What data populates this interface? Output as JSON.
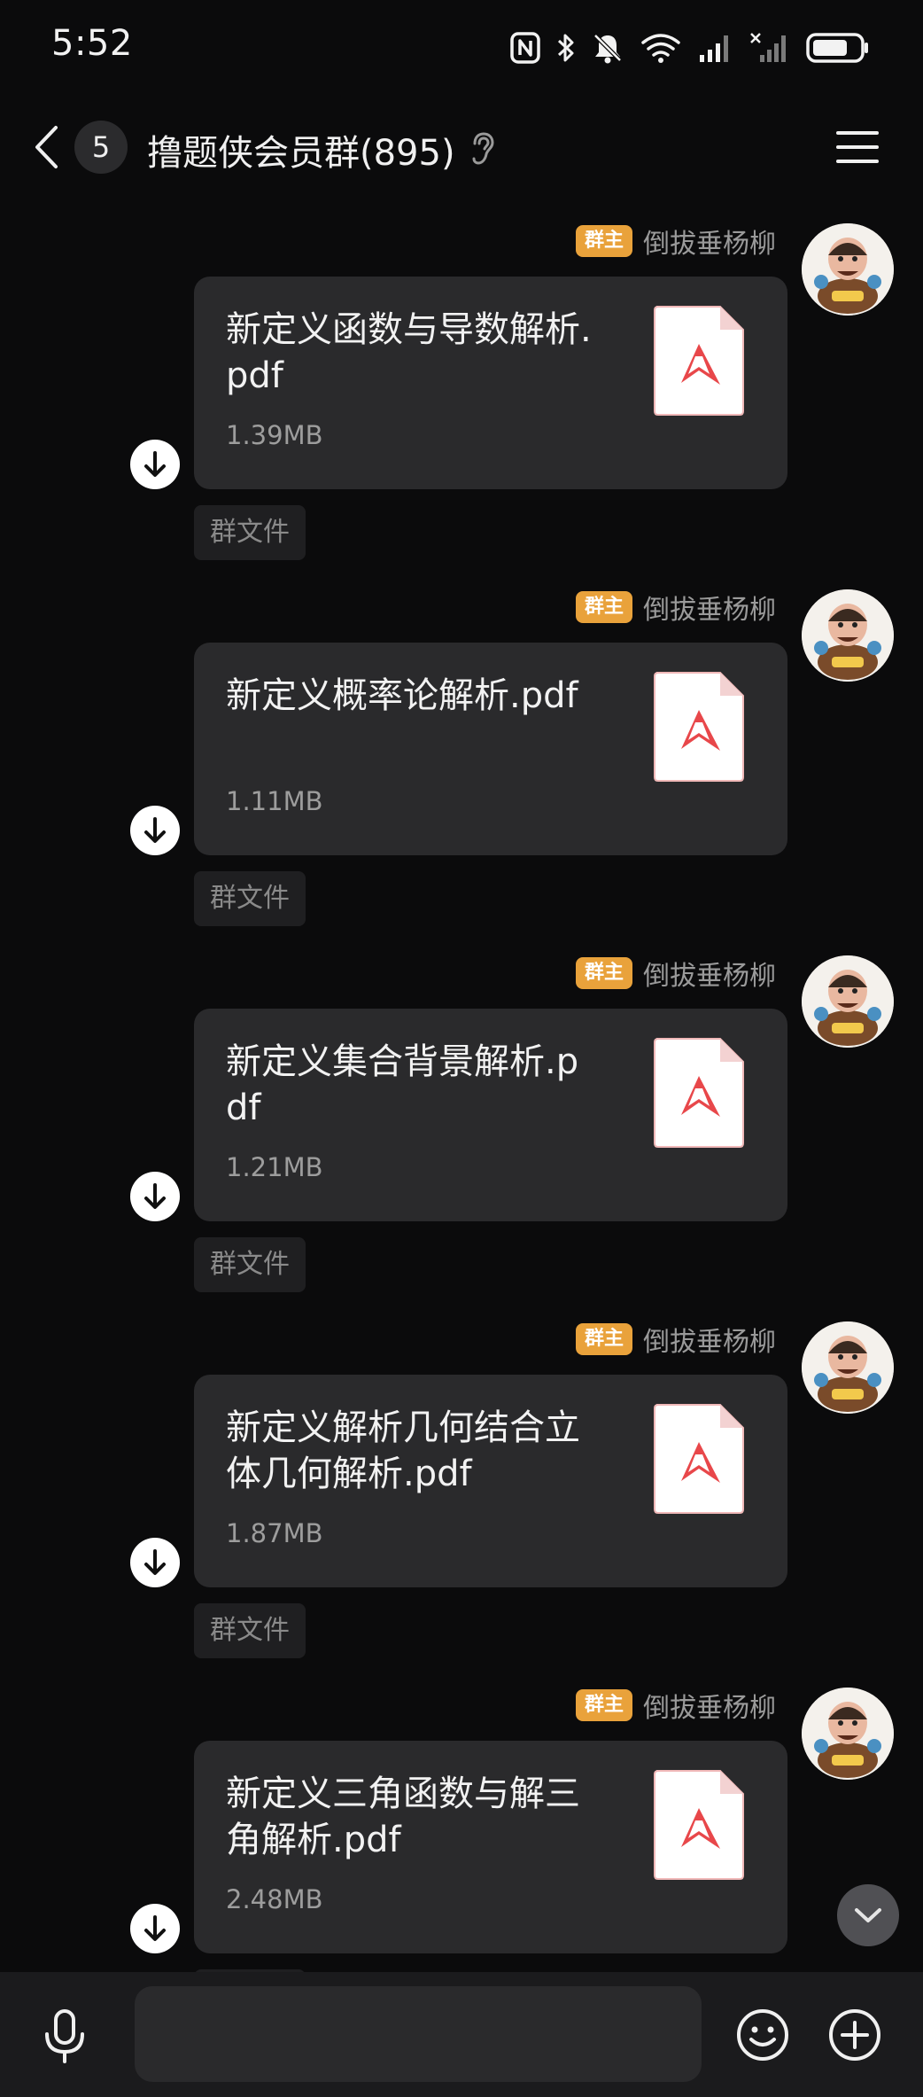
{
  "status_bar": {
    "time": "5:52"
  },
  "header": {
    "unread_count": "5",
    "title": "撸题侠会员群(895)"
  },
  "messages": [
    {
      "role_badge": "群主",
      "sender": "倒拔垂杨柳",
      "file_name": "新定义函数与导数解析.pdf",
      "file_size": "1.39MB",
      "tag": "群文件"
    },
    {
      "role_badge": "群主",
      "sender": "倒拔垂杨柳",
      "file_name": "新定义概率论解析.pdf",
      "file_size": "1.11MB",
      "tag": "群文件"
    },
    {
      "role_badge": "群主",
      "sender": "倒拔垂杨柳",
      "file_name": "新定义集合背景解析.pdf",
      "file_size": "1.21MB",
      "tag": "群文件"
    },
    {
      "role_badge": "群主",
      "sender": "倒拔垂杨柳",
      "file_name": "新定义解析几何结合立体几何解析.pdf",
      "file_size": "1.87MB",
      "tag": "群文件"
    },
    {
      "role_badge": "群主",
      "sender": "倒拔垂杨柳",
      "file_name": "新定义三角函数与解三角解析.pdf",
      "file_size": "2.48MB",
      "tag": "群文件"
    }
  ],
  "input": {
    "placeholder": ""
  },
  "colors": {
    "background": "#0b0b0c",
    "bubble": "#2a2a2c",
    "owner_badge": "#e9a23b",
    "pdf_red": "#e8474a"
  },
  "icons": {
    "back": "chevron-left-icon",
    "ear": "ear-icon",
    "menu": "menu-icon",
    "download": "download-arrow-icon",
    "pdf": "pdf-file-icon",
    "mic": "microphone-icon",
    "emoji": "smiley-icon",
    "plus": "plus-circle-icon",
    "scroll_down": "chevron-down-icon"
  }
}
